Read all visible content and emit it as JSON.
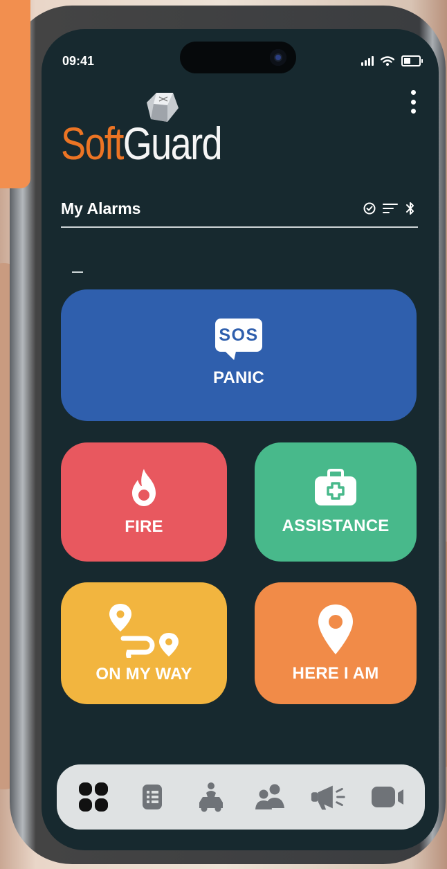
{
  "status_bar": {
    "time": "09:41",
    "signal_icon": "signal-icon",
    "wifi_icon": "wifi-icon",
    "battery_icon": "battery-icon"
  },
  "brand": {
    "logo_left": "Soft",
    "logo_right": "Guard",
    "logo_colors": {
      "left": "#ec7424",
      "right": "#f5f5f5"
    }
  },
  "header": {
    "title": "My Alarms",
    "icons": [
      "check-circle-icon",
      "filter-icon",
      "bluetooth-icon"
    ]
  },
  "tiles": {
    "panic": {
      "icon_text": "SOS",
      "label": "PANIC",
      "color": "#2f5fad",
      "icon": "sos-bubble-icon"
    },
    "fire": {
      "label": "FIRE",
      "color": "#e8585f",
      "icon": "flame-icon"
    },
    "assistance": {
      "label": "ASSISTANCE",
      "color": "#48b98b",
      "icon": "first-aid-kit-icon"
    },
    "on_my_way": {
      "label": "ON MY WAY",
      "color": "#f2b53f",
      "icon": "route-icon"
    },
    "here_i_am": {
      "label": "HERE I AM",
      "color": "#f18b48",
      "icon": "map-pin-icon"
    }
  },
  "bottom_nav": {
    "items": [
      "grid-icon",
      "list-icon",
      "car-person-icon",
      "contacts-icon",
      "megaphone-icon",
      "video-camera-icon"
    ],
    "active_index": 0
  }
}
